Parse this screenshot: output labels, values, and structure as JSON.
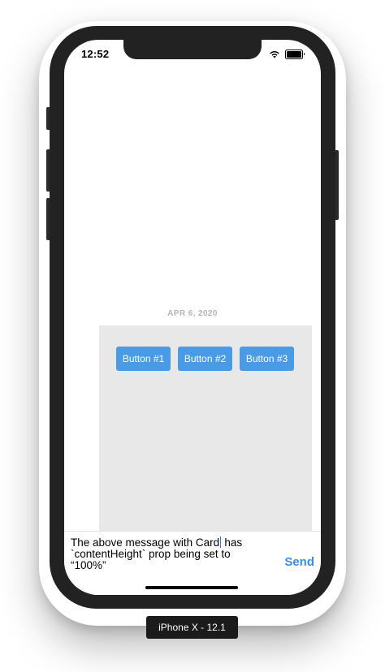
{
  "status_bar": {
    "time": "12:52",
    "icons": [
      "wifi-icon",
      "battery-icon"
    ],
    "battery_level": 1.0
  },
  "chat": {
    "date_label": "APR 6, 2020",
    "card": {
      "background": "#e8e8e8",
      "buttons": [
        {
          "label": "Button #1"
        },
        {
          "label": "Button #2"
        },
        {
          "label": "Button #3"
        }
      ],
      "button_color": "#4a9be6"
    }
  },
  "composer": {
    "text_before_caret": "The above message with Card",
    "text_after_caret": " has\n`contentHeight` prop being set to\n“100%”",
    "send_label": "Send",
    "send_color": "#3c8de0"
  },
  "simulator": {
    "device_label": "iPhone X - 12.1"
  }
}
